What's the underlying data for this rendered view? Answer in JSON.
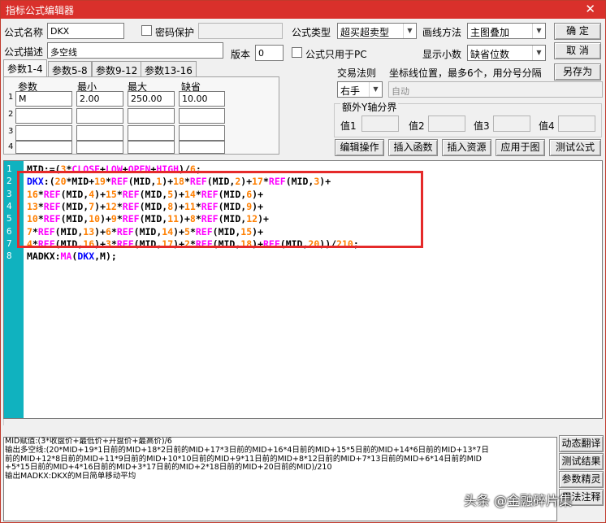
{
  "window": {
    "title": "指标公式编辑器",
    "close_icon": "✕"
  },
  "form": {
    "name_label": "公式名称",
    "name_value": "DKX",
    "pwd_label": "密码保护",
    "type_label": "公式类型",
    "type_value": "超买超卖型",
    "draw_label": "画线方法",
    "draw_value": "主图叠加",
    "desc_label": "公式描述",
    "desc_value": "多空线",
    "version_label": "版本",
    "version_value": "0",
    "pc_label": "公式只用于PC",
    "decimals_label": "显示小数",
    "decimals_value": "缺省位数"
  },
  "buttons": {
    "ok": "确 定",
    "cancel": "取 消",
    "saveas": "另存为"
  },
  "tabs": [
    "参数1-4",
    "参数5-8",
    "参数9-12",
    "参数13-16"
  ],
  "params": {
    "headers": [
      "参数",
      "最小",
      "最大",
      "缺省"
    ],
    "rows": [
      {
        "idx": "1",
        "name": "M",
        "min": "2.00",
        "max": "250.00",
        "def": "10.00"
      },
      {
        "idx": "2",
        "name": "",
        "min": "",
        "max": "",
        "def": ""
      },
      {
        "idx": "3",
        "name": "",
        "min": "",
        "max": "",
        "def": ""
      },
      {
        "idx": "4",
        "name": "",
        "min": "",
        "max": "",
        "def": ""
      }
    ]
  },
  "trade": {
    "label": "交易法则",
    "hint": "坐标线位置，最多6个，用分号分隔",
    "value": "右手",
    "auto": "自动"
  },
  "axis": {
    "label": "额外Y轴分界",
    "v1": "值1",
    "v2": "值2",
    "v3": "值3",
    "v4": "值4"
  },
  "actions": [
    "编辑操作",
    "插入函数",
    "插入资源",
    "应用于图",
    "测试公式"
  ],
  "code": {
    "line_numbers": [
      "1",
      "2",
      "3",
      "4",
      "5",
      "6",
      "7",
      "8"
    ],
    "lines": [
      [
        [
          "n",
          "MID:=("
        ],
        [
          "num",
          "3"
        ],
        [
          "n",
          "*"
        ],
        [
          "k",
          "CLOSE"
        ],
        [
          "n",
          "+"
        ],
        [
          "k",
          "LOW"
        ],
        [
          "n",
          "+"
        ],
        [
          "k",
          "OPEN"
        ],
        [
          "n",
          "+"
        ],
        [
          "k",
          "HIGH"
        ],
        [
          "n",
          ")/"
        ],
        [
          "num",
          "6"
        ],
        [
          "n",
          ";"
        ]
      ],
      [
        [
          "v",
          "DKX"
        ],
        [
          "n",
          ":("
        ],
        [
          "num",
          "20"
        ],
        [
          "n",
          "*MID+"
        ],
        [
          "num",
          "19"
        ],
        [
          "n",
          "*"
        ],
        [
          "k",
          "REF"
        ],
        [
          "n",
          "(MID,"
        ],
        [
          "num",
          "1"
        ],
        [
          "n",
          ")+"
        ],
        [
          "num",
          "18"
        ],
        [
          "n",
          "*"
        ],
        [
          "k",
          "REF"
        ],
        [
          "n",
          "(MID,"
        ],
        [
          "num",
          "2"
        ],
        [
          "n",
          ")+"
        ],
        [
          "num",
          "17"
        ],
        [
          "n",
          "*"
        ],
        [
          "k",
          "REF"
        ],
        [
          "n",
          "(MID,"
        ],
        [
          "num",
          "3"
        ],
        [
          "n",
          ")+"
        ]
      ],
      [
        [
          "num",
          "16"
        ],
        [
          "n",
          "*"
        ],
        [
          "k",
          "REF"
        ],
        [
          "n",
          "(MID,"
        ],
        [
          "num",
          "4"
        ],
        [
          "n",
          ")+"
        ],
        [
          "num",
          "15"
        ],
        [
          "n",
          "*"
        ],
        [
          "k",
          "REF"
        ],
        [
          "n",
          "(MID,"
        ],
        [
          "num",
          "5"
        ],
        [
          "n",
          ")+"
        ],
        [
          "num",
          "14"
        ],
        [
          "n",
          "*"
        ],
        [
          "k",
          "REF"
        ],
        [
          "n",
          "(MID,"
        ],
        [
          "num",
          "6"
        ],
        [
          "n",
          ")+"
        ]
      ],
      [
        [
          "num",
          "13"
        ],
        [
          "n",
          "*"
        ],
        [
          "k",
          "REF"
        ],
        [
          "n",
          "(MID,"
        ],
        [
          "num",
          "7"
        ],
        [
          "n",
          ")+"
        ],
        [
          "num",
          "12"
        ],
        [
          "n",
          "*"
        ],
        [
          "k",
          "REF"
        ],
        [
          "n",
          "(MID,"
        ],
        [
          "num",
          "8"
        ],
        [
          "n",
          ")+"
        ],
        [
          "num",
          "11"
        ],
        [
          "n",
          "*"
        ],
        [
          "k",
          "REF"
        ],
        [
          "n",
          "(MID,"
        ],
        [
          "num",
          "9"
        ],
        [
          "n",
          ")+"
        ]
      ],
      [
        [
          "num",
          "10"
        ],
        [
          "n",
          "*"
        ],
        [
          "k",
          "REF"
        ],
        [
          "n",
          "(MID,"
        ],
        [
          "num",
          "10"
        ],
        [
          "n",
          ")+"
        ],
        [
          "num",
          "9"
        ],
        [
          "n",
          "*"
        ],
        [
          "k",
          "REF"
        ],
        [
          "n",
          "(MID,"
        ],
        [
          "num",
          "11"
        ],
        [
          "n",
          ")+"
        ],
        [
          "num",
          "8"
        ],
        [
          "n",
          "*"
        ],
        [
          "k",
          "REF"
        ],
        [
          "n",
          "(MID,"
        ],
        [
          "num",
          "12"
        ],
        [
          "n",
          ")+"
        ]
      ],
      [
        [
          "num",
          "7"
        ],
        [
          "n",
          "*"
        ],
        [
          "k",
          "REF"
        ],
        [
          "n",
          "(MID,"
        ],
        [
          "num",
          "13"
        ],
        [
          "n",
          ")+"
        ],
        [
          "num",
          "6"
        ],
        [
          "n",
          "*"
        ],
        [
          "k",
          "REF"
        ],
        [
          "n",
          "(MID,"
        ],
        [
          "num",
          "14"
        ],
        [
          "n",
          ")+"
        ],
        [
          "num",
          "5"
        ],
        [
          "n",
          "*"
        ],
        [
          "k",
          "REF"
        ],
        [
          "n",
          "(MID,"
        ],
        [
          "num",
          "15"
        ],
        [
          "n",
          ")+"
        ]
      ],
      [
        [
          "num",
          "4"
        ],
        [
          "n",
          "*"
        ],
        [
          "k",
          "REF"
        ],
        [
          "n",
          "(MID,"
        ],
        [
          "num",
          "16"
        ],
        [
          "n",
          ")+"
        ],
        [
          "num",
          "3"
        ],
        [
          "n",
          "*"
        ],
        [
          "k",
          "REF"
        ],
        [
          "n",
          "(MID,"
        ],
        [
          "num",
          "17"
        ],
        [
          "n",
          ")+"
        ],
        [
          "num",
          "2"
        ],
        [
          "n",
          "*"
        ],
        [
          "k",
          "REF"
        ],
        [
          "n",
          "(MID,"
        ],
        [
          "num",
          "18"
        ],
        [
          "n",
          ")+"
        ],
        [
          "k",
          "REF"
        ],
        [
          "n",
          "(MID,"
        ],
        [
          "num",
          "20"
        ],
        [
          "n",
          "))/"
        ],
        [
          "num",
          "210"
        ],
        [
          "n",
          ";"
        ]
      ],
      [
        [
          "n",
          "MADKX:"
        ],
        [
          "k",
          "MA"
        ],
        [
          "n",
          "("
        ],
        [
          "v",
          "DKX"
        ],
        [
          "n",
          ",M);"
        ]
      ]
    ]
  },
  "description": [
    "MID赋值:(3*收盘价+最低价+开盘价+最高价)/6",
    "输出多空线:(20*MID+19*1日前的MID+18*2日前的MID+17*3日前的MID+16*4日前的MID+15*5日前的MID+14*6日前的MID+13*7日",
    "前的MID+12*8日前的MID+11*9日前的MID+10*10日前的MID+9*11日前的MID+8*12日前的MID+7*13日前的MID+6*14日前的MID",
    "+5*15日前的MID+4*16日前的MID+3*17日前的MID+2*18日前的MID+20日前的MID)/210",
    "输出MADKX:DKX的M日简单移动平均"
  ],
  "side_buttons": [
    "动态翻译",
    "测试结果",
    "参数精灵",
    "用法注释"
  ],
  "watermark": "头条 @金融碎片集",
  "colors": {
    "title_bar": "#d9302b",
    "gutter": "#10b2bf",
    "highlight_box": "#e52a2a",
    "keyword": "#ff00ff",
    "number": "#ff7f00",
    "variable": "#0000ff"
  }
}
